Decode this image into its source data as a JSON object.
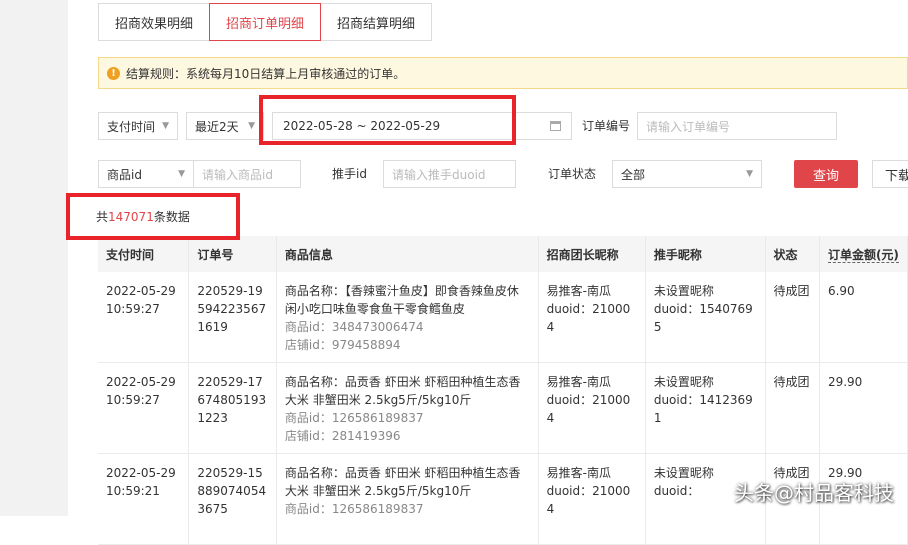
{
  "tabs": [
    "招商效果明细",
    "招商订单明细",
    "招商结算明细"
  ],
  "active_tab": 1,
  "notice": "结算规则：系统每月10日结算上月审核通过的订单。",
  "filters": {
    "time_type": "支付时间",
    "time_range": "最近2天",
    "date_range": "2022-05-28 ~ 2022-05-29",
    "order_no_label": "订单编号",
    "order_no_placeholder": "请输入订单编号",
    "product_id_type": "商品id",
    "product_id_placeholder": "请输入商品id",
    "promoter_label": "推手id",
    "promoter_placeholder": "请输入推手duoid",
    "status_label": "订单状态",
    "status_value": "全部",
    "query_button": "查询",
    "download_button": "下载"
  },
  "summary": {
    "prefix": "共",
    "count": "147071",
    "suffix": "条数据"
  },
  "table": {
    "columns": [
      "支付时间",
      "订单号",
      "商品信息",
      "招商团长昵称",
      "推手昵称",
      "状态",
      "订单金额(元)"
    ],
    "rows": [
      {
        "pay_time": "2022-05-29 10:59:27",
        "order_no": "220529-195942235671619",
        "product_name": "商品名称：【香辣蜜汁鱼皮】即食香辣鱼皮休闲小吃口味鱼零食鱼干零食鳕鱼皮",
        "product_id": "商品id：348473006474",
        "shop_id": "店铺id：979458894",
        "leader_name": "易推客-南瓜",
        "leader_duoid": "duoid：210004",
        "promoter_name": "未设置昵称",
        "promoter_duoid": "duoid：15407695",
        "status": "待成团",
        "amount": "6.90"
      },
      {
        "pay_time": "2022-05-29 10:59:27",
        "order_no": "220529-176748051931223",
        "product_name": "商品名称：品贡香 虾田米 虾稻田种植生态香大米 非蟹田米 2.5kg5斤/5kg10斤",
        "product_id": "商品id：126586189837",
        "shop_id": "店铺id：281419396",
        "leader_name": "易推客-南瓜",
        "leader_duoid": "duoid：210004",
        "promoter_name": "未设置昵称",
        "promoter_duoid": "duoid：14123691",
        "status": "待成团",
        "amount": "29.90"
      },
      {
        "pay_time": "2022-05-29 10:59:21",
        "order_no": "220529-158890740543675",
        "product_name": "商品名称：品贡香 虾田米 虾稻田种植生态香大米 非蟹田米 2.5kg5斤/5kg10斤",
        "product_id": "商品id：126586189837",
        "shop_id": "",
        "leader_name": "易推客-南瓜",
        "leader_duoid": "duoid：210004",
        "promoter_name": "未设置昵称",
        "promoter_duoid": "duoid：",
        "status": "待成团",
        "amount": "29.90"
      }
    ]
  },
  "watermark": "头条@村品客科技",
  "colors": {
    "accent": "#e0454a",
    "highlight": "#e8232a",
    "notice_bg": "#fff8e1"
  }
}
